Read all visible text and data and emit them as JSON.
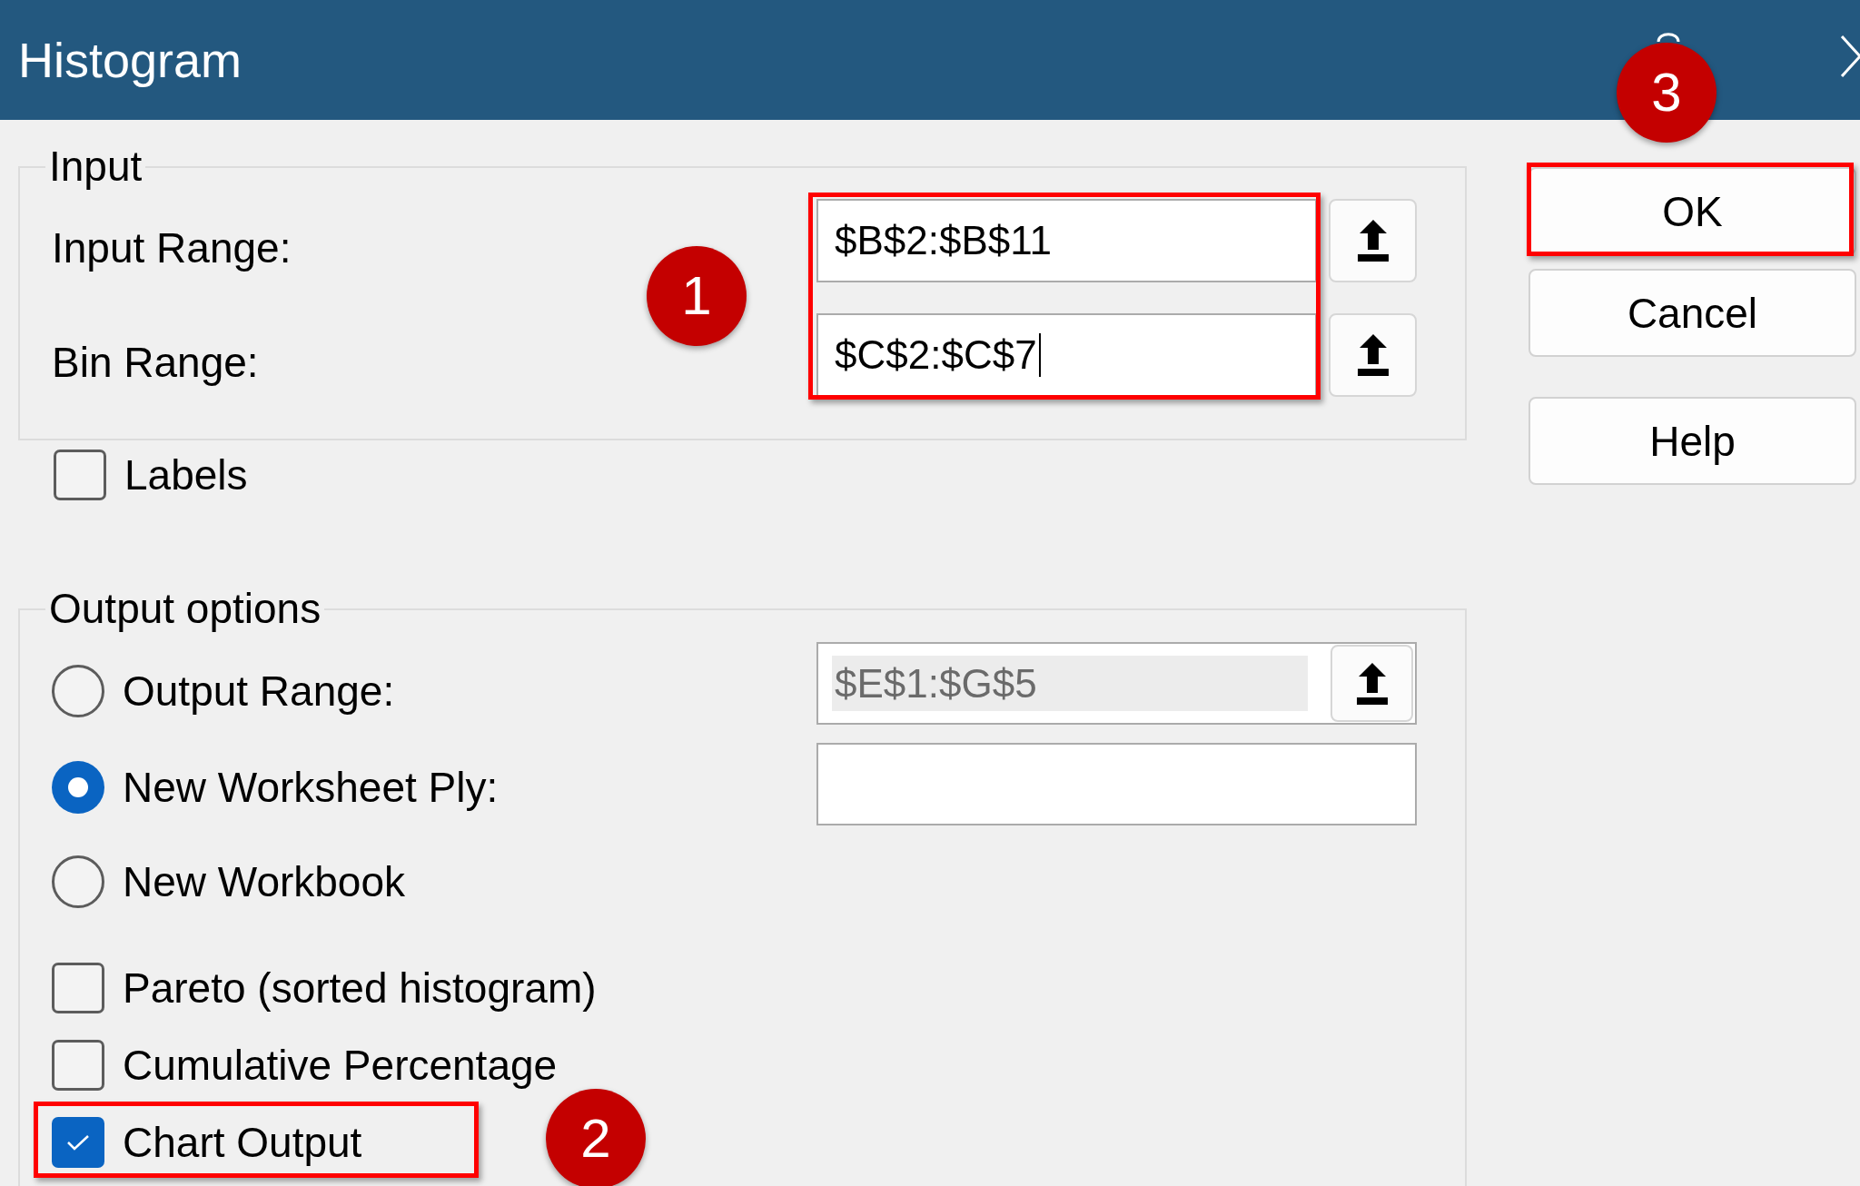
{
  "window": {
    "title": "Histogram"
  },
  "input_group": {
    "legend": "Input",
    "highlighted": true,
    "callout": "1",
    "fields": [
      {
        "label": "Input Range:",
        "value": "$B$2:$B$11",
        "focused": false
      },
      {
        "label": "Bin Range:",
        "value": "$C$2:$C$7",
        "focused": true
      }
    ]
  },
  "labels_checkbox": {
    "label": "Labels",
    "checked": false
  },
  "output_group": {
    "legend": "Output options",
    "options": [
      {
        "label": "Output Range:",
        "selected": false,
        "field": {
          "kind": "range",
          "value": "$E$1:$G$5",
          "disabled": true
        }
      },
      {
        "label": "New Worksheet Ply:",
        "selected": true,
        "field": {
          "kind": "text"
        }
      },
      {
        "label": "New Workbook",
        "selected": false
      }
    ],
    "checkboxes": [
      {
        "label": "Pareto (sorted histogram)",
        "checked": false,
        "highlighted": false
      },
      {
        "label": "Cumulative Percentage",
        "checked": false,
        "highlighted": false
      },
      {
        "label": "Chart Output",
        "checked": true,
        "highlighted": true,
        "callout": "2"
      }
    ]
  },
  "buttons": [
    {
      "label": "OK",
      "highlighted": true,
      "callout": "3"
    },
    {
      "label": "Cancel",
      "highlighted": false
    },
    {
      "label": "Help",
      "highlighted": false
    }
  ]
}
